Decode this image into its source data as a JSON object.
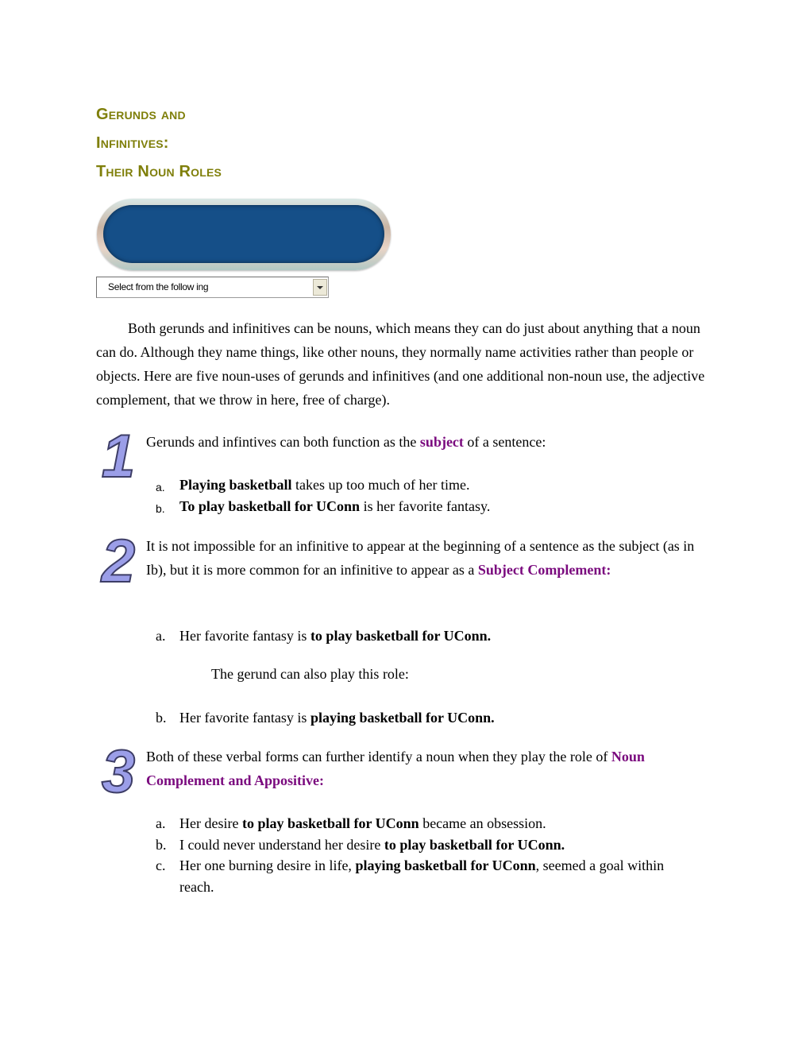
{
  "title": {
    "lines": [
      "Gerunds and",
      "Infinitives:",
      "Their Noun Roles"
    ]
  },
  "navigation": {
    "select": {
      "selected": "Select from the follow ing"
    }
  },
  "intro": "Both gerunds and infinitives can be nouns, which means they can do just about anything that a noun can do. Although they name things, like other nouns, they normally name activities rather than people or objects. Here are five noun-uses of gerunds and infinitives (and one additional non-noun use, the adjective complement, that we throw in here, free of charge).",
  "sections": [
    {
      "number": "1",
      "text_before": "Gerunds and infintives can both function as the ",
      "highlight": "subject",
      "text_after": " of a sentence:",
      "examples": [
        {
          "marker": "a.",
          "bold": "Playing basketball",
          "after": " takes up too much of her time."
        },
        {
          "marker": "b.",
          "bold": "To play basketball for UConn",
          "after": " is her favorite fantasy."
        }
      ]
    },
    {
      "number": "2",
      "text_before": "It is not impossible for an infinitive to appear at the beginning of a sentence as the subject (as in Ib), but it is more common for an infinitive to appear as a ",
      "highlight": "Subject Complement:",
      "examples": [
        {
          "marker": "a.",
          "before": "Her favorite fantasy is ",
          "bold": "to play basketball for UConn."
        },
        {
          "marker": "b.",
          "before": "Her favorite fantasy is ",
          "bold": "playing basketball for UConn."
        }
      ],
      "note": "The gerund can also play this role:"
    },
    {
      "number": "3",
      "text_before": "Both of these verbal forms can further identify a noun when they play the role of ",
      "highlight": "Noun Complement and Appositive:",
      "examples": [
        {
          "marker": "a.",
          "before": "Her desire ",
          "bold": "to play basketball for UConn",
          "after": " became an obsession."
        },
        {
          "marker": "b.",
          "before": "I could never understand her desire ",
          "bold": "to play basketball for UConn."
        },
        {
          "marker": "c.",
          "before": "Her one burning desire in life, ",
          "bold": "playing basketball for UConn",
          "after": ", seemed a goal within reach."
        }
      ]
    }
  ],
  "colors": {
    "title": "#7f7f0a",
    "highlight": "#7a0a7e",
    "banner": "#154f88"
  }
}
